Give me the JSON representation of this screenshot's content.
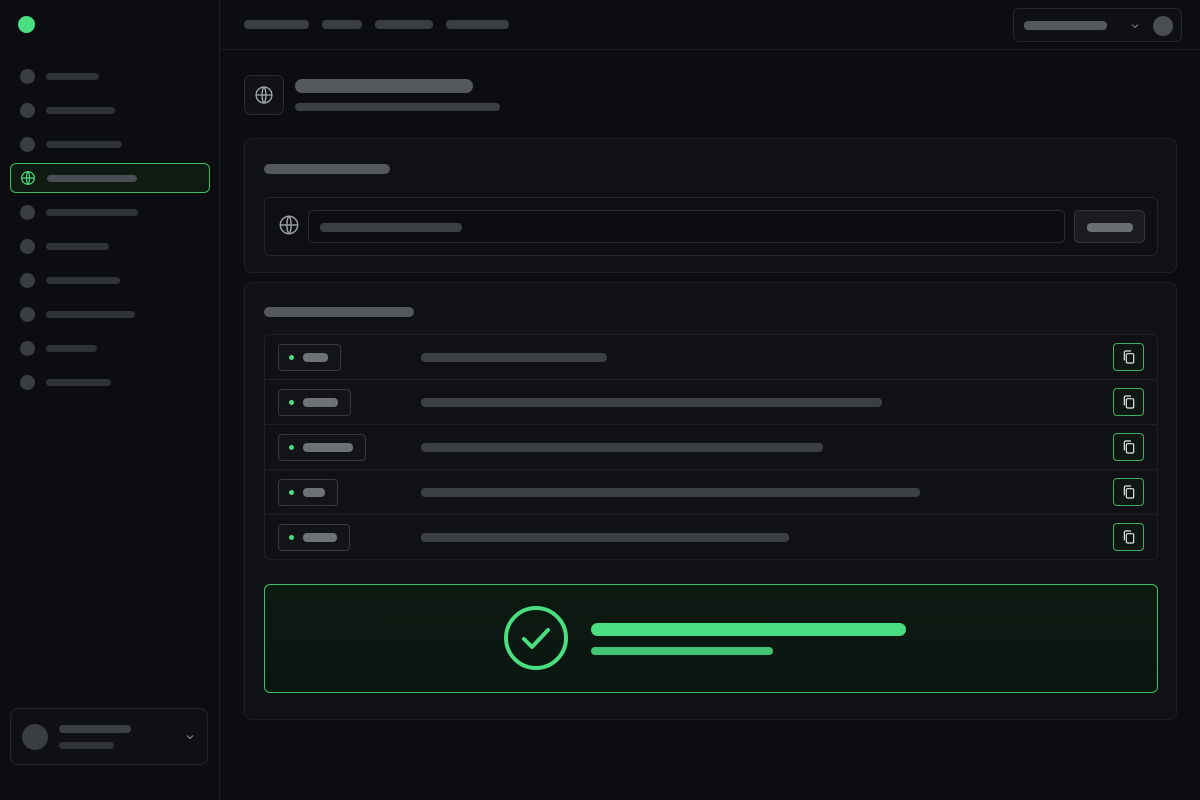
{
  "theme": {
    "background": "#0b0d10",
    "accent": "#4ade80",
    "accent_border": "#3fbf6a",
    "surface": "#0f1114"
  },
  "sidebar": {
    "brand": {
      "icon": "brand-dot-icon"
    },
    "items": [
      {
        "icon": "circle-icon"
      },
      {
        "icon": "circle-icon"
      },
      {
        "icon": "circle-icon"
      },
      {
        "icon": "globe-icon",
        "active": true
      },
      {
        "icon": "circle-icon"
      },
      {
        "icon": "circle-icon"
      },
      {
        "icon": "circle-icon"
      },
      {
        "icon": "circle-icon"
      },
      {
        "icon": "circle-icon"
      },
      {
        "icon": "circle-icon"
      }
    ],
    "user_card": {
      "avatar": "avatar-icon",
      "chevron": "chevron-down-icon"
    }
  },
  "topbar": {
    "breadcrumb_count": 4,
    "workspace_select": {
      "chevron": "chevron-down-icon",
      "avatar": "avatar-icon"
    }
  },
  "page": {
    "icon": "globe-icon"
  },
  "domain_card": {
    "field_icon": "globe-icon"
  },
  "records_card": {
    "records": [
      {
        "status_color": "#4ade80",
        "action_icon": "copy-icon"
      },
      {
        "status_color": "#4ade80",
        "action_icon": "copy-icon"
      },
      {
        "status_color": "#4ade80",
        "action_icon": "copy-icon"
      },
      {
        "status_color": "#4ade80",
        "action_icon": "copy-icon"
      },
      {
        "status_color": "#4ade80",
        "action_icon": "copy-icon"
      }
    ]
  },
  "success_banner": {
    "icon": "check-circle-icon",
    "color": "#4ade80"
  }
}
